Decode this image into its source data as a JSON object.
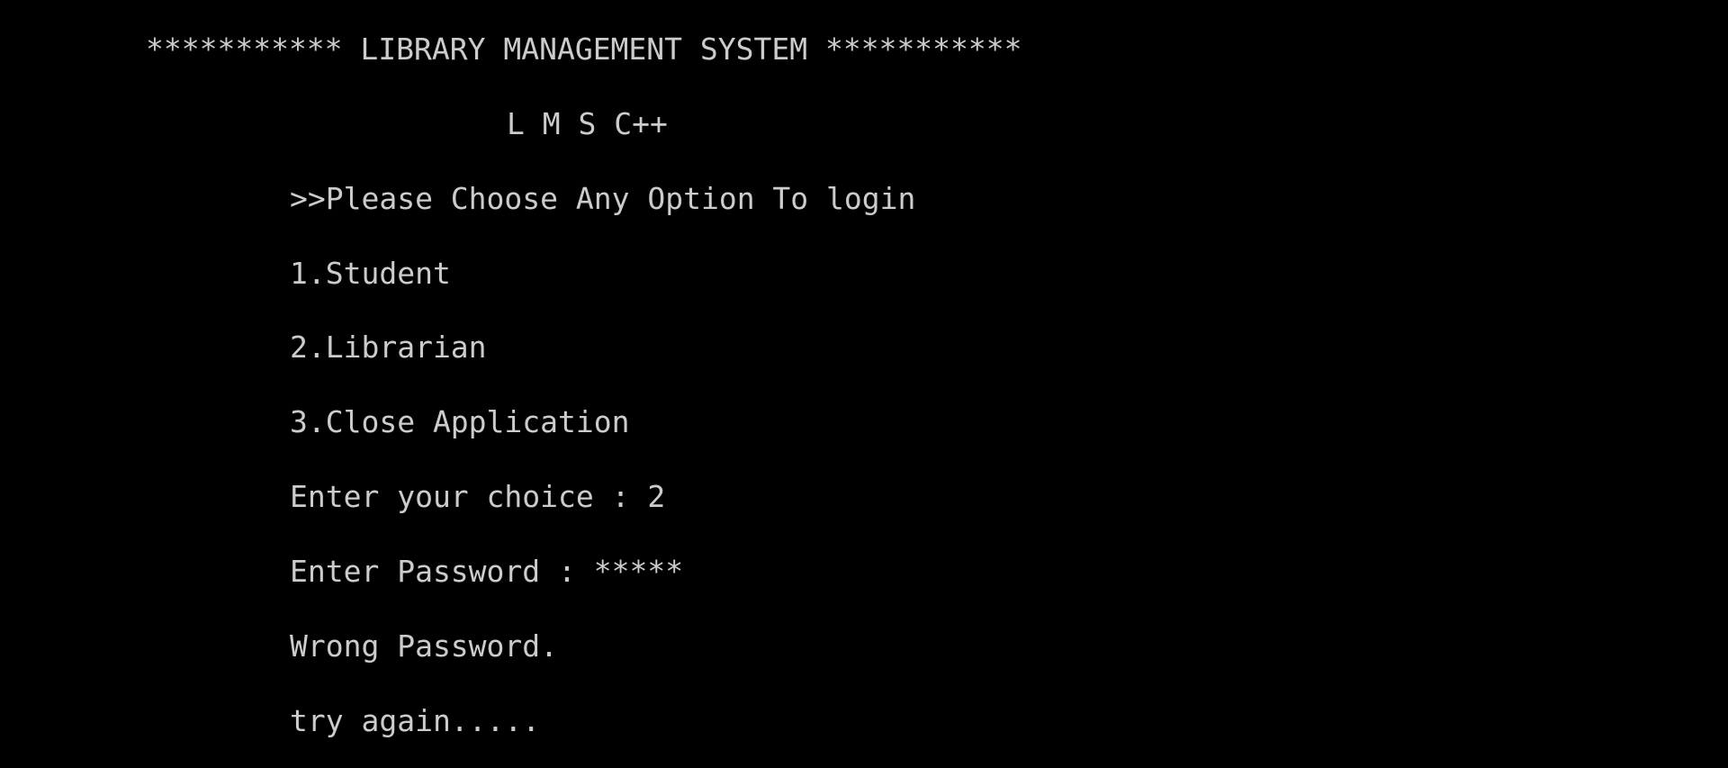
{
  "console": {
    "colors": {
      "background": "#000000",
      "text": "#cccccc"
    },
    "header": {
      "title": "*********** LIBRARY MANAGEMENT SYSTEM ***********",
      "subtitle": "L M S C++"
    },
    "menu": {
      "prompt": ">>Please Choose Any Option To login",
      "options": [
        "1.Student",
        "2.Librarian",
        "3.Close Application"
      ]
    },
    "choice": {
      "label": "Enter your choice : ",
      "value": "2"
    },
    "password": {
      "label": "Enter Password : ",
      "masked_value": "*****"
    },
    "messages": {
      "error": "Wrong Password.",
      "retry": "try again....."
    }
  }
}
